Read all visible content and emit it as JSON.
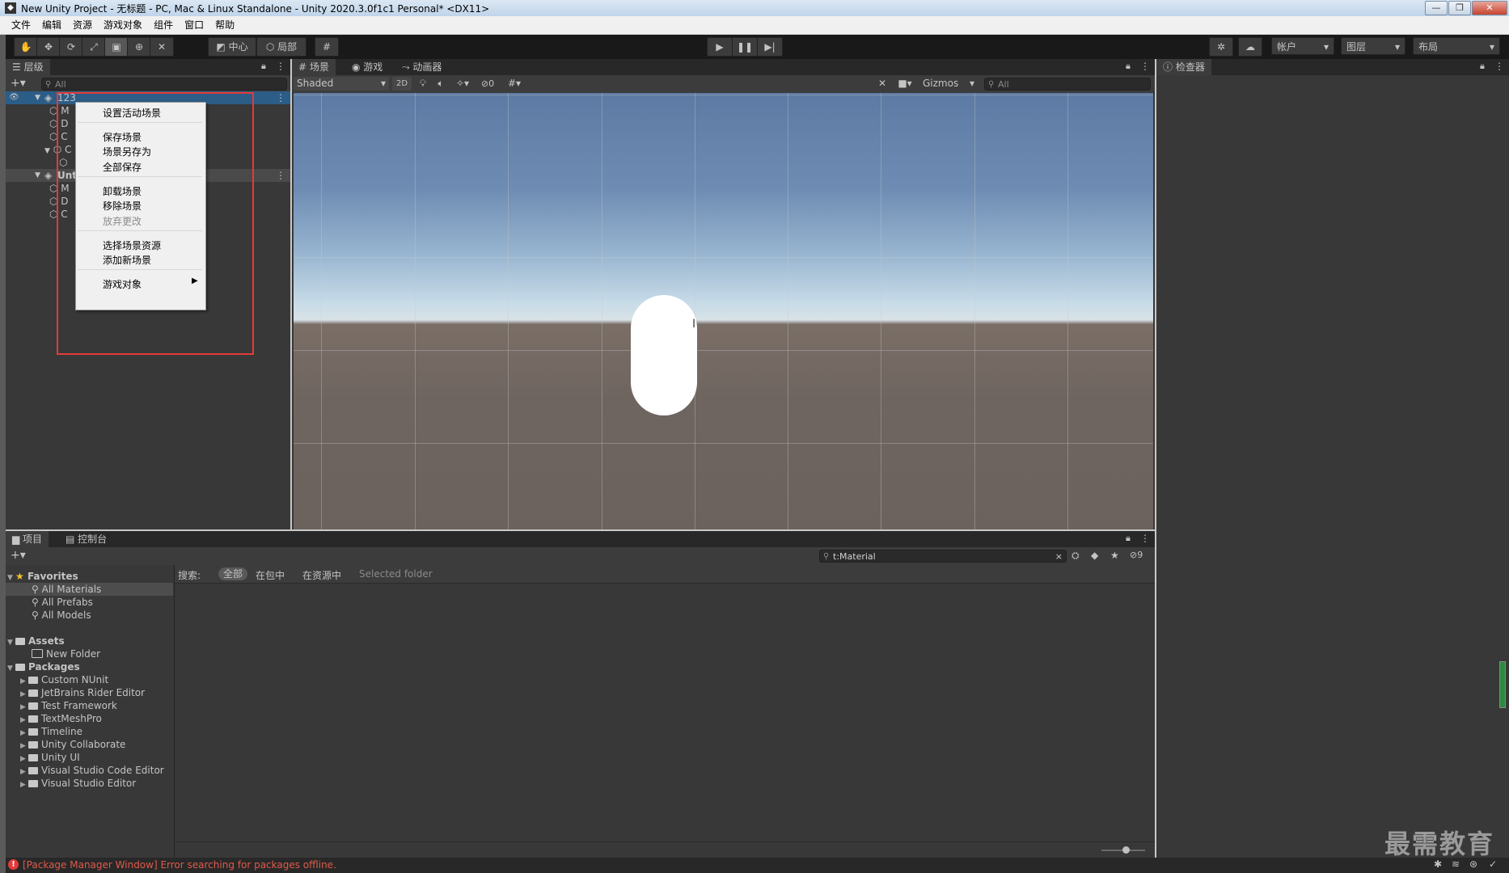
{
  "window": {
    "title": "New Unity Project - 无标题 - PC, Mac & Linux Standalone - Unity 2020.3.0f1c1 Personal* <DX11>",
    "controls": [
      "—",
      "❐",
      "✕"
    ]
  },
  "menubar": [
    "文件",
    "编辑",
    "资源",
    "游戏对象",
    "组件",
    "窗口",
    "帮助"
  ],
  "toolbar": {
    "pivot": "中心",
    "space": "局部",
    "account": "帐户",
    "layers": "图层",
    "layout": "布局"
  },
  "hierarchy": {
    "tab": "层级",
    "search_placeholder": "All",
    "scenes": [
      {
        "name": "123",
        "selected": true
      },
      {
        "name": "Unt",
        "selected": false
      }
    ],
    "child_letters": [
      "M",
      "D",
      "C",
      "C",
      "M",
      "D",
      "C"
    ]
  },
  "context_menu": {
    "items": [
      {
        "label": "设置活动场景",
        "enabled": true
      },
      {
        "label": "保存场景",
        "enabled": true
      },
      {
        "label": "场景另存为",
        "enabled": true
      },
      {
        "label": "全部保存",
        "enabled": true
      },
      {
        "label": "卸载场景",
        "enabled": true
      },
      {
        "label": "移除场景",
        "enabled": true
      },
      {
        "label": "放弃更改",
        "enabled": false
      },
      {
        "label": "选择场景资源",
        "enabled": true
      },
      {
        "label": "添加新场景",
        "enabled": true
      },
      {
        "label": "游戏对象",
        "enabled": true,
        "submenu": true
      }
    ]
  },
  "scene_view": {
    "tabs": [
      "场景",
      "游戏",
      "动画器"
    ],
    "shading": "Shaded",
    "mode_2d": "2D",
    "hidden_count": "0",
    "gizmos": "Gizmos",
    "search_placeholder": "All"
  },
  "inspector": {
    "tab": "检查器"
  },
  "project": {
    "tabs": [
      "项目",
      "控制台"
    ],
    "search_value": "t:Material",
    "hidden_count": "9",
    "search_label": "搜索:",
    "filters": [
      "全部",
      "在包中",
      "在资源中",
      "Selected folder"
    ],
    "favorites_label": "Favorites",
    "favorites": [
      "All Materials",
      "All Prefabs",
      "All Models"
    ],
    "assets_label": "Assets",
    "assets": [
      "New Folder"
    ],
    "packages_label": "Packages",
    "packages": [
      "Custom NUnit",
      "JetBrains Rider Editor",
      "Test Framework",
      "TextMeshPro",
      "Timeline",
      "Unity Collaborate",
      "Unity UI",
      "Visual Studio Code Editor",
      "Visual Studio Editor"
    ]
  },
  "status": {
    "message": "[Package Manager Window] Error searching for packages offline."
  },
  "watermark": "最需教育",
  "colors": {
    "accent": "#2c5d87",
    "error": "#e53a3a",
    "panel": "#383838"
  }
}
